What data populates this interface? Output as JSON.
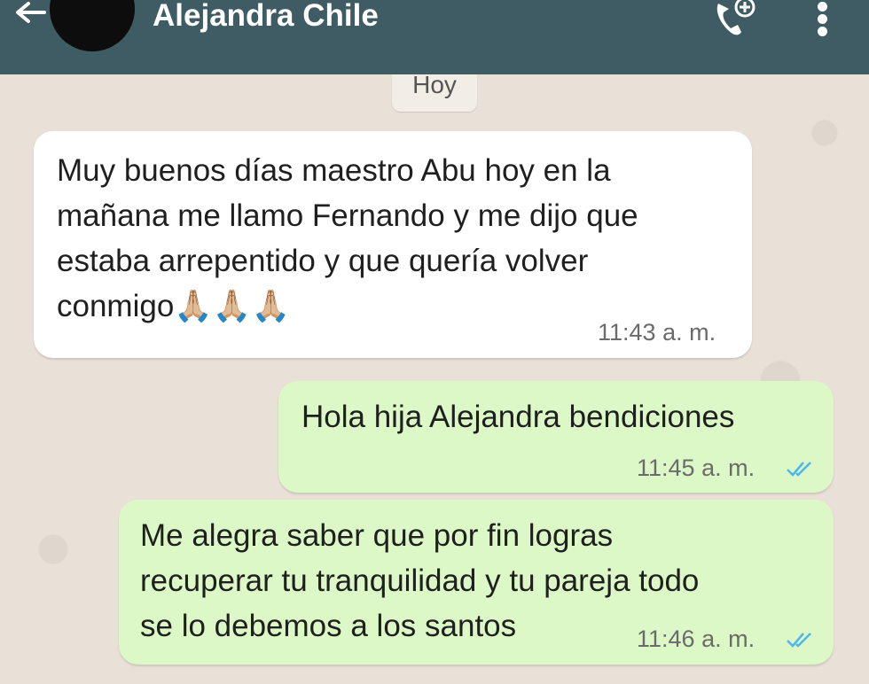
{
  "header": {
    "contact_name": "Alejandra Chile",
    "back_icon": "arrow-left-icon",
    "call_icon": "add-call-icon",
    "menu_icon": "more-vertical-icon",
    "color": "#3f5b63"
  },
  "date_separator": "Hoy",
  "messages": [
    {
      "direction": "incoming",
      "lines": [
        "Muy buenos días maestro Abu hoy en la",
        "mañana me llamo Fernando y me dijo que",
        "estaba arrepentido y que quería volver",
        "conmigo🙏🏼🙏🏼🙏🏼"
      ],
      "time": "11:43 a. m."
    },
    {
      "direction": "outgoing",
      "lines": [
        "Hola hija Alejandra  bendiciones"
      ],
      "time": "11:45 a. m.",
      "status": "read"
    },
    {
      "direction": "outgoing",
      "lines": [
        "Me alegra saber que por fin logras",
        "recuperar  tu tranquilidad  y tu pareja todo",
        "se lo debemos a los santos"
      ],
      "time": "11:46 a. m.",
      "status": "read"
    }
  ],
  "colors": {
    "incoming_bubble": "#ffffff",
    "outgoing_bubble": "#dcf8c6",
    "read_ticks": "#4fb6ec",
    "wallpaper": "#e9e1d8"
  }
}
